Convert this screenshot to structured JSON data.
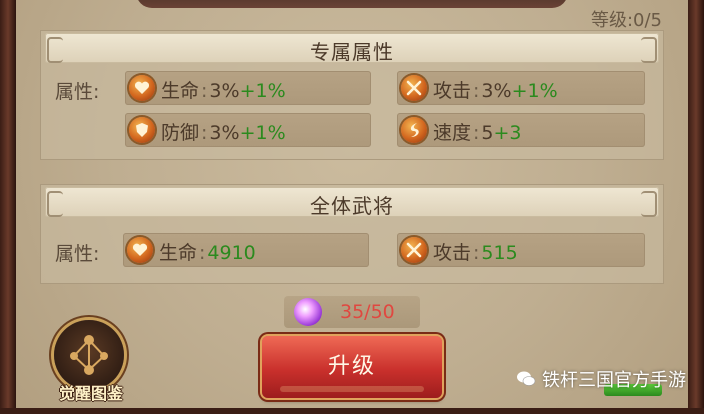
{
  "level": {
    "text": "等级:0/5"
  },
  "exclusive": {
    "title": "专属属性",
    "row_label": "属性:",
    "stats": [
      {
        "icon": "heart-icon",
        "name": "生命",
        "sep": ":",
        "value": "3%",
        "bonus": "+1%"
      },
      {
        "icon": "sword-icon",
        "name": "攻击",
        "sep": ":",
        "value": "3%",
        "bonus": "+1%"
      },
      {
        "icon": "shield-icon",
        "name": "防御",
        "sep": ":",
        "value": "3%",
        "bonus": "+1%"
      },
      {
        "icon": "speed-icon",
        "name": "速度",
        "sep": ":",
        "value": "5",
        "bonus": "+3"
      }
    ]
  },
  "all_generals": {
    "title": "全体武将",
    "row_label": "属性:",
    "stats": [
      {
        "icon": "heart-icon",
        "name": "生命",
        "sep": ":",
        "value": "4910"
      },
      {
        "icon": "sword-icon",
        "name": "攻击",
        "sep": ":",
        "value": "515"
      }
    ]
  },
  "cost": {
    "icon": "purple-gem-icon",
    "text": "35/50",
    "color": "#e04840"
  },
  "upgrade_button": {
    "label": "升级"
  },
  "awaken_book": {
    "label": "觉醒图鉴"
  },
  "watermark": {
    "text": "铁杆三国官方手游"
  },
  "colors": {
    "bonus_green": "#2b8a1e",
    "button_red": "#c9302c"
  }
}
